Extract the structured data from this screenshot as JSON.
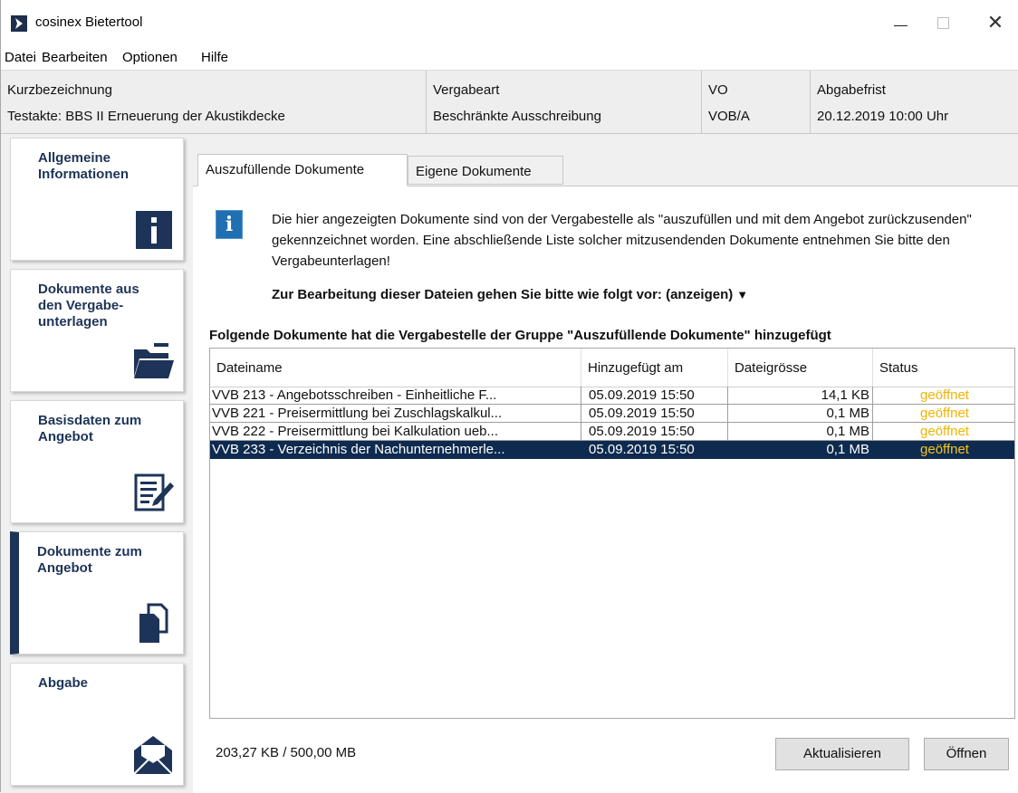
{
  "window": {
    "title": "cosinex Bietertool"
  },
  "menu": [
    "Datei",
    "Bearbeiten",
    "Optionen",
    "Hilfe"
  ],
  "header": {
    "columns": [
      {
        "label": "Kurzbezeichnung",
        "value": "Testakte: BBS II Erneuerung der Akustikdecke"
      },
      {
        "label": "Vergabeart",
        "value": "Beschränkte Ausschreibung"
      },
      {
        "label": "VO",
        "value": "VOB/A"
      },
      {
        "label": "Abgabefrist",
        "value": "20.12.2019 10:00 Uhr"
      }
    ]
  },
  "sidebar": {
    "items": [
      {
        "label": "Allgemeine Informationen",
        "icon": "info-icon",
        "active": false
      },
      {
        "label": "Dokumente aus den Vergabe-unterlagen",
        "icon": "folder-icon",
        "active": false
      },
      {
        "label": "Basisdaten zum Angebot",
        "icon": "edit-document-icon",
        "active": false
      },
      {
        "label": "Dokumente zum Angebot",
        "icon": "documents-icon",
        "active": true
      },
      {
        "label": "Abgabe",
        "icon": "envelope-icon",
        "active": false
      }
    ]
  },
  "tabs": [
    {
      "label": "Auszufüllende Dokumente",
      "active": true
    },
    {
      "label": "Eigene Dokumente",
      "active": false
    }
  ],
  "notice": {
    "text": "Die hier angezeigten Dokumente sind von der Vergabestelle als \"auszufüllen und mit dem Angebot zurückzusenden\" gekennzeichnet worden. Eine abschließende Liste solcher mitzusendenden Dokumente entnehmen Sie bitte den Vergabeunterlagen!",
    "instructions": "Zur Bearbeitung dieser Dateien gehen Sie bitte wie folgt vor: (anzeigen)"
  },
  "group_heading": "Folgende Dokumente hat die Vergabestelle der Gruppe \"Auszufüllende Dokumente\" hinzugefügt",
  "table": {
    "columns": [
      "Dateiname",
      "Hinzugefügt am",
      "Dateigrösse",
      "Status"
    ],
    "rows": [
      {
        "name": "VVB 213 - Angebotsschreiben - Einheitliche F...",
        "date": "05.09.2019 15:50",
        "size": "14,1 KB",
        "status": "geöffnet",
        "selected": false
      },
      {
        "name": "VVB 221 - Preisermittlung bei Zuschlagskalkul...",
        "date": "05.09.2019 15:50",
        "size": "0,1 MB",
        "status": "geöffnet",
        "selected": false
      },
      {
        "name": "VVB 222 - Preisermittlung bei Kalkulation ueb...",
        "date": "05.09.2019 15:50",
        "size": "0,1 MB",
        "status": "geöffnet",
        "selected": false
      },
      {
        "name": "VVB 233 - Verzeichnis der Nachunternehmerle...",
        "date": "05.09.2019 15:50",
        "size": "0,1 MB",
        "status": "geöffnet",
        "selected": true
      }
    ]
  },
  "footer": {
    "storage": "203,27 KB / 500,00 MB",
    "refresh_label": "Aktualisieren",
    "open_label": "Öffnen"
  },
  "colors": {
    "nav_accent": "#1d3458",
    "selected_row": "#0e2a4f",
    "status_text": "#f0b400",
    "info_icon": "#1f6fb2"
  }
}
